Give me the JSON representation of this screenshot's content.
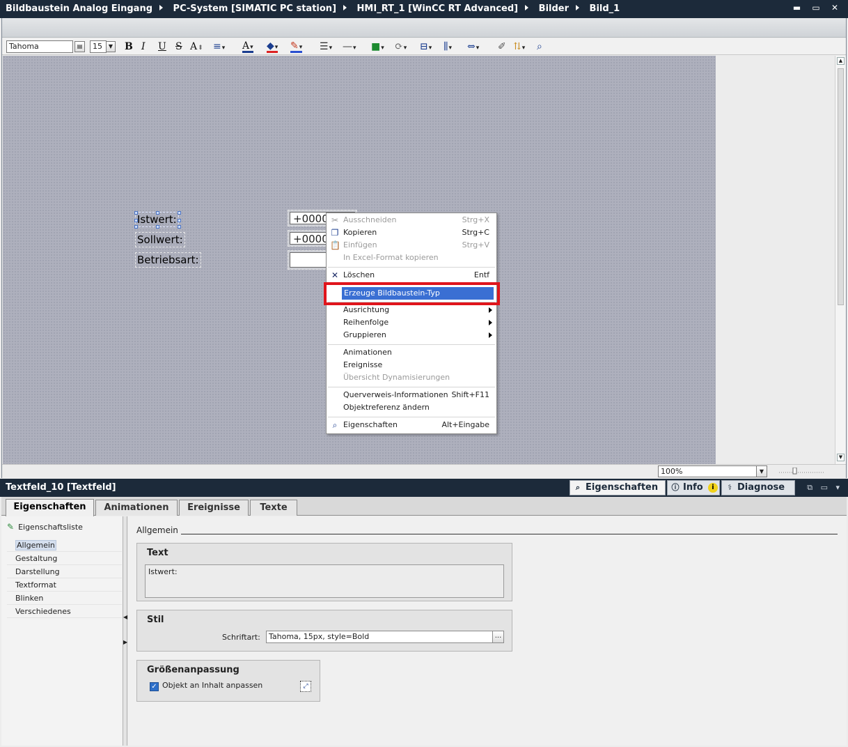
{
  "titlebar": {
    "crumbs": [
      "Bildbaustein Analog Eingang",
      "PC-System [SIMATIC PC station]",
      "HMI_RT_1 [WinCC RT Advanced]",
      "Bilder",
      "Bild_1"
    ],
    "window_buttons": "▬ ▭ ✕"
  },
  "toolbar": {
    "font_name": "Tahoma",
    "font_size": "15",
    "bold": "B",
    "italic": "I",
    "underline": "U",
    "strike": "S",
    "fontsize_grow": "A",
    "align": "≡",
    "font_color": "A"
  },
  "canvas": {
    "labels": [
      "Istwert:",
      "Sollwert:",
      "Betriebsart:"
    ],
    "io_fields": [
      "+0000",
      "+0000",
      ""
    ]
  },
  "status": {
    "zoom": "100%"
  },
  "context_menu": {
    "items": [
      {
        "label": "Ausschneiden",
        "shortcut": "Strg+X",
        "disabled": true,
        "icon": "scissors-icon"
      },
      {
        "label": "Kopieren",
        "shortcut": "Strg+C",
        "disabled": false,
        "icon": "copy-icon"
      },
      {
        "label": "Einfügen",
        "shortcut": "Strg+V",
        "disabled": true,
        "icon": "paste-icon"
      },
      {
        "label": "In Excel-Format kopieren",
        "shortcut": "",
        "disabled": true
      },
      {
        "label": "Löschen",
        "shortcut": "Entf",
        "disabled": false,
        "icon": "delete-icon"
      },
      {
        "label": "Erzeuge Bildbaustein-Typ",
        "shortcut": "",
        "highlighted": true
      },
      {
        "label": "Ausrichtung",
        "submenu": true
      },
      {
        "label": "Reihenfolge",
        "submenu": true
      },
      {
        "label": "Gruppieren",
        "submenu": true
      },
      {
        "label": "Animationen"
      },
      {
        "label": "Ereignisse"
      },
      {
        "label": "Übersicht Dynamisierungen",
        "disabled": true
      },
      {
        "label": "Querverweis-Informationen",
        "shortcut": "Shift+F11"
      },
      {
        "label": "Objektreferenz ändern"
      },
      {
        "label": "Eigenschaften",
        "shortcut": "Alt+Eingabe",
        "icon": "properties-icon"
      }
    ]
  },
  "inspector": {
    "title": "Textfeld_10 [Textfeld]",
    "top_tabs": [
      {
        "label": "Eigenschaften",
        "icon": "properties-icon"
      },
      {
        "label": "Info",
        "icon": "info-icon"
      },
      {
        "label": "Diagnose",
        "icon": "diagnose-icon"
      }
    ],
    "info_badge": "i",
    "window_buttons": "⧉ ▭ ▾",
    "tabs": [
      "Eigenschaften",
      "Animationen",
      "Ereignisse",
      "Texte"
    ],
    "propertylist_label": "Eigenschaftsliste",
    "nav": [
      "Allgemein",
      "Gestaltung",
      "Darstellung",
      "Textformat",
      "Blinken",
      "Verschiedenes"
    ],
    "section_title": "Allgemein",
    "group_text": {
      "title": "Text",
      "value": "Istwert:"
    },
    "group_style": {
      "title": "Stil",
      "font_label": "Schriftart:",
      "font_value": "Tahoma, 15px, style=Bold",
      "browse": "..."
    },
    "group_size": {
      "title": "Größenanpassung",
      "checkbox_label": "Objekt an Inhalt anpassen",
      "checked": true
    }
  },
  "colors": {
    "titlebar": "#1c2a3a",
    "canvas": "#aeb0bd",
    "highlight": "#3a6fd3",
    "callout": "#e0151c"
  }
}
